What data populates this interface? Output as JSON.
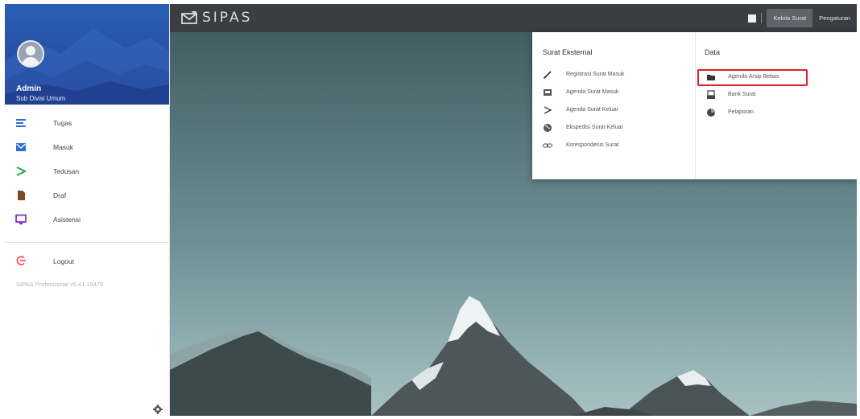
{
  "app": {
    "logo_text": "SIPAS"
  },
  "profile": {
    "name": "Admin",
    "role": "Sub Divisi Umum"
  },
  "menu": [
    {
      "label": "Tugas",
      "icon": "list-icon",
      "color": "#2f6ed8"
    },
    {
      "label": "Masuk",
      "icon": "mail-icon",
      "color": "#2f6ed8"
    },
    {
      "label": "Tedusan",
      "icon": "send-icon",
      "color": "#2aa54a"
    },
    {
      "label": "Draf",
      "icon": "document-icon",
      "color": "#7a4a2a"
    },
    {
      "label": "Asistensi",
      "icon": "monitor-icon",
      "color": "#8a2bd0"
    }
  ],
  "logout": {
    "label": "Logout",
    "icon": "logout-icon",
    "color": "#e44"
  },
  "version": "SIPAS Professional v5.41.19470",
  "topbar": {
    "active_button": "Kelola Surat",
    "settings_button": "Pengaturan"
  },
  "dropdown": {
    "external": {
      "title": "Surat Eksternal",
      "items": [
        {
          "label": "Registrasi Surat Masuk",
          "icon": "pencil-icon"
        },
        {
          "label": "Agenda Surat Masuk",
          "icon": "inbox-icon"
        },
        {
          "label": "Agenda Surat Keluar",
          "icon": "send-icon"
        },
        {
          "label": "Ekspedisi Surat Keluar",
          "icon": "globe-icon"
        },
        {
          "label": "Korespondensi Surat",
          "icon": "link-icon"
        }
      ]
    },
    "data": {
      "title": "Data",
      "items": [
        {
          "label": "Agenda Arsip Bebas",
          "icon": "folder-icon",
          "highlighted": true
        },
        {
          "label": "Bank Surat",
          "icon": "archive-icon"
        },
        {
          "label": "Pelaporan",
          "icon": "chart-icon"
        }
      ]
    }
  },
  "colors": {
    "topbar": "#3a3d41",
    "sidebar_header": "#2852a8",
    "highlight": "#d8222a"
  }
}
